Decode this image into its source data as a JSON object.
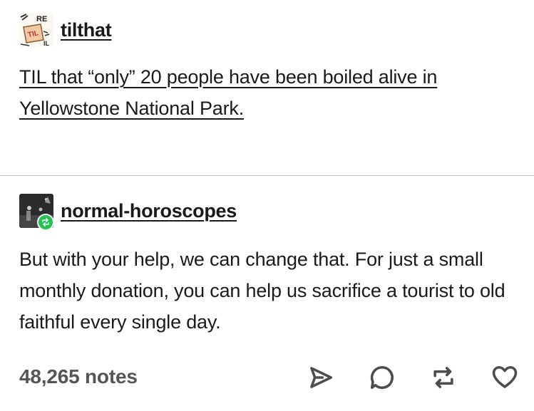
{
  "original_post": {
    "avatar_icon": "til-logo-icon",
    "avatar_lettering": [
      "RE",
      "TIL",
      "IL"
    ],
    "username": "tilthat",
    "text": "TIL that “only” 20 people have been boiled alive in Yellowstone National Park."
  },
  "reblog": {
    "avatar_icon": "night-sky-photo-icon",
    "badge_icon": "reblog-badge-icon",
    "username": "normal-horoscopes",
    "text": "But with your help, we can change that. For just a small monthly donation, you can help us sacrifice a tourist to old faithful every single day."
  },
  "footer": {
    "notes": "48,265 notes",
    "actions": [
      "share-icon",
      "reply-icon",
      "reblog-icon",
      "like-icon"
    ]
  },
  "colors": {
    "text": "#1a1a1a",
    "notes": "#555555",
    "divider": "#c9c9c9",
    "reblog_badge": "#23c152",
    "icons": "#4d4d4d"
  }
}
